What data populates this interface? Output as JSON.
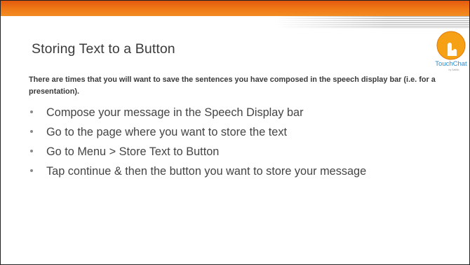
{
  "slide": {
    "title": "Storing Text to a Button",
    "intro": "There are times that you will want to save the sentences you have composed in the speech display bar (i.e. for a presentation).",
    "bullets": [
      "Compose your message in the Speech Display bar",
      "Go to the page where you want to store the text",
      "Go to Menu > Store Text to Button",
      "Tap continue & then the button you want to store your message"
    ]
  },
  "logo": {
    "text": "TouchChat",
    "sub": "by Saltillo",
    "icon": "touchchat-logo-icon"
  },
  "colors": {
    "accent": "#f07a16",
    "text": "#3a3a3a",
    "logo_blue": "#2e8bd0"
  }
}
